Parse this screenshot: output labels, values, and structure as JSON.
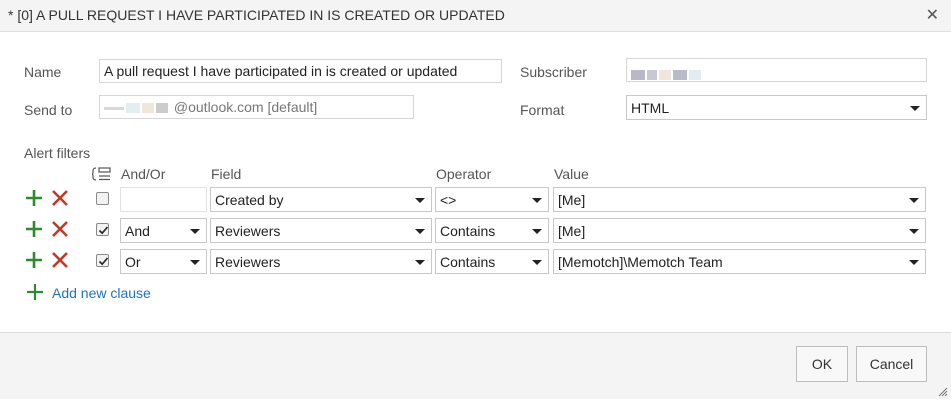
{
  "dialog": {
    "title": "* [0] A PULL REQUEST I HAVE PARTICIPATED IN IS CREATED OR UPDATED",
    "close_icon": "close-icon"
  },
  "form": {
    "name_label": "Name",
    "name_value": "A pull request I have participated in is created or updated",
    "send_to_label": "Send to",
    "send_to_value": "@outlook.com [default]",
    "subscriber_label": "Subscriber",
    "format_label": "Format",
    "format_value": "HTML"
  },
  "filters": {
    "section_label": "Alert filters",
    "headers": {
      "and_or": "And/Or",
      "field": "Field",
      "operator": "Operator",
      "value": "Value"
    },
    "rows": [
      {
        "checked": false,
        "and_or": "",
        "field": "Created by",
        "operator": "<>",
        "value": "[Me]"
      },
      {
        "checked": true,
        "and_or": "And",
        "field": "Reviewers",
        "operator": "Contains",
        "value": "[Me]"
      },
      {
        "checked": true,
        "and_or": "Or",
        "field": "Reviewers",
        "operator": "Contains",
        "value": "[Memotch]\\Memotch Team"
      }
    ],
    "add_clause_label": "Add new clause"
  },
  "footer": {
    "ok_label": "OK",
    "cancel_label": "Cancel"
  },
  "colors": {
    "add_green": "#2e8b2e",
    "delete_red": "#c0392b",
    "link_blue": "#1e73be"
  }
}
